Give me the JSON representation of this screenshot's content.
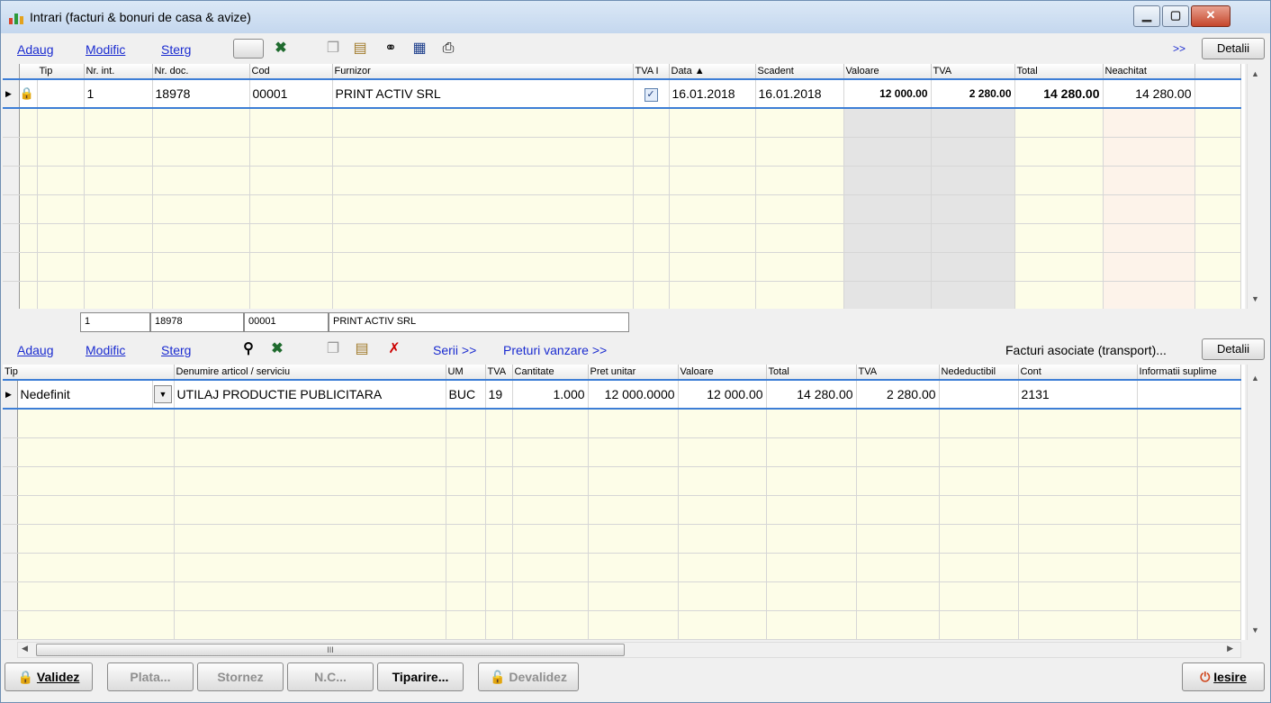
{
  "window": {
    "title": "Intrari (facturi & bonuri de casa & avize)",
    "min": "▁",
    "max": "▢",
    "close": "✕"
  },
  "toolbar1": {
    "add": "Adaug",
    "modify": "Modific",
    "delete": "Sterg",
    "more": ">>",
    "details": "Detalii"
  },
  "grid1": {
    "headers": [
      "Tip",
      "Nr. int.",
      "Nr. doc.",
      "Cod",
      "Furnizor",
      "TVA I",
      "Data ▲",
      "Scadent",
      "Valoare",
      "TVA",
      "Total",
      "Neachitat"
    ],
    "row": {
      "nr_int": "1",
      "nr_doc": "18978",
      "cod": "00001",
      "furnizor": "PRINT ACTIV SRL",
      "tva_check": "✓",
      "data": "16.01.2018",
      "scadent": "16.01.2018",
      "valoare": "12 000.00",
      "tva": "2 280.00",
      "total": "14 280.00",
      "neachitat": "14 280.00"
    }
  },
  "summary": {
    "nr_int": "1",
    "nr_doc": "18978",
    "cod": "00001",
    "furnizor": "PRINT ACTIV SRL"
  },
  "toolbar2": {
    "add": "Adaug",
    "modify": "Modific",
    "delete": "Sterg",
    "series": "Serii >>",
    "prices": "Preturi vanzare >>",
    "assoc": "Facturi asociate (transport)...",
    "details": "Detalii"
  },
  "grid2": {
    "headers": [
      "Tip",
      "Denumire articol / serviciu",
      "UM",
      "TVA",
      "Cantitate",
      "Pret unitar",
      "Valoare",
      "Total",
      "TVA",
      "Nedeductibil",
      "Cont",
      "Informatii suplime"
    ],
    "row": {
      "tip": "Nedefinit",
      "denumire": "UTILAJ PRODUCTIE PUBLICITARA",
      "um": "BUC",
      "tva": "19",
      "cantitate": "1.000",
      "pret": "12 000.0000",
      "valoare": "12 000.00",
      "total": "14 280.00",
      "tva_val": "2 280.00",
      "nedeductibil": "",
      "cont": "2131",
      "info": ""
    }
  },
  "hscroll_grip": "III",
  "footer": {
    "validate": "Validez",
    "pay": "Plata...",
    "storno": "Stornez",
    "nc": "N.C...",
    "print": "Tiparire...",
    "devalidate": "Devalidez",
    "exit": "Iesire"
  }
}
